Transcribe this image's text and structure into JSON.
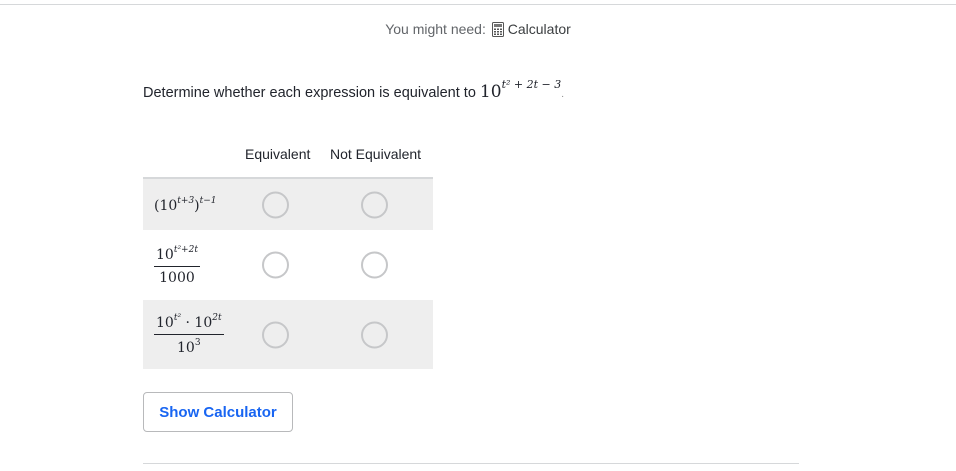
{
  "header": {
    "might_need_label": "You might need:",
    "tool_label": "Calculator",
    "tool_icon": "calculator-icon"
  },
  "question": {
    "prompt": "Determine whether each expression is equivalent to",
    "target_base": "10",
    "target_exp": "t² + 2t − 3",
    "target_trailing": "."
  },
  "table": {
    "columns": [
      "Equivalent",
      "Not Equivalent"
    ],
    "rows": [
      {
        "expr_text": "(10^(t+3))^(t−1)",
        "equivalent_selected": false,
        "not_equivalent_selected": false
      },
      {
        "expr_text": "10^(t²+2t) / 1000",
        "equivalent_selected": false,
        "not_equivalent_selected": false
      },
      {
        "expr_text": "10^(t²) · 10^(2t) / 10³",
        "equivalent_selected": false,
        "not_equivalent_selected": false
      }
    ]
  },
  "actions": {
    "show_calculator_label": "Show Calculator"
  },
  "colors": {
    "accent": "#1865f2",
    "row_shade": "#eeeeee",
    "radio_border": "#c6c7c9"
  }
}
